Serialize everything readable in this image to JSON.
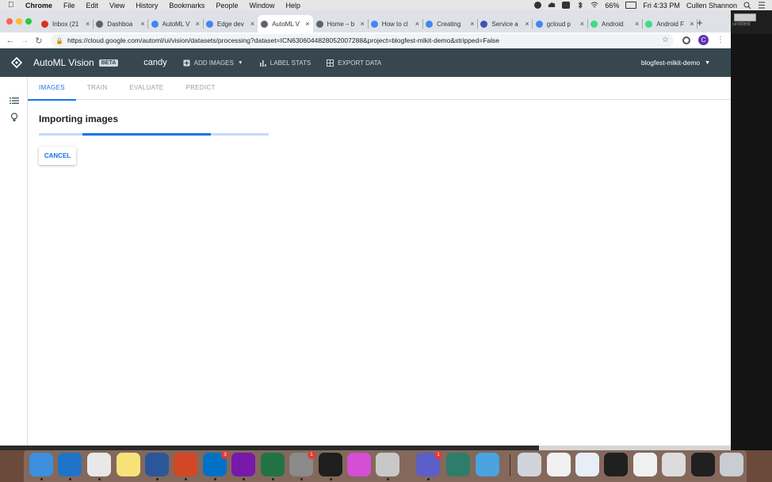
{
  "menubar": {
    "app": "Chrome",
    "items": [
      "File",
      "Edit",
      "View",
      "History",
      "Bookmarks",
      "People",
      "Window",
      "Help"
    ],
    "battery": "66%",
    "clock": "Fri 4:33 PM",
    "user": "Cullen Shannon"
  },
  "browser": {
    "tabs": [
      {
        "label": "Inbox (21",
        "icon": "gmail-icon",
        "color": "#d93025"
      },
      {
        "label": "Dashboa",
        "icon": "gear-icon",
        "color": "#5f6368"
      },
      {
        "label": "AutoML V",
        "icon": "gcloud-icon",
        "color": "#4285f4"
      },
      {
        "label": "Edge dev",
        "icon": "gcloud-icon",
        "color": "#4285f4"
      },
      {
        "label": "AutoML V",
        "icon": "gear-icon",
        "color": "#5f6368"
      },
      {
        "label": "Home – b",
        "icon": "gear-icon",
        "color": "#5f6368"
      },
      {
        "label": "How to cl",
        "icon": "gcloud-icon",
        "color": "#4285f4"
      },
      {
        "label": "Creating",
        "icon": "gcloud-icon",
        "color": "#4285f4"
      },
      {
        "label": "Service a",
        "icon": "shield-icon",
        "color": "#3f51b5"
      },
      {
        "label": "gcloud p",
        "icon": "google-icon",
        "color": "#4285f4"
      },
      {
        "label": "Android",
        "icon": "android-icon",
        "color": "#3ddc84"
      },
      {
        "label": "Android F",
        "icon": "android-icon",
        "color": "#3ddc84"
      }
    ],
    "active_tab": 4,
    "url": "https://cloud.google.com/automl/ui/vision/datasets/processing?dataset=ICN6306044828052007288&project=blogfest-mlkit-demo&stripped=False",
    "profile_initial": "C"
  },
  "app": {
    "name": "AutoML Vision",
    "beta": "BETA",
    "dataset": "candy",
    "actions": {
      "add_images": "ADD IMAGES",
      "label_stats": "LABEL STATS",
      "export_data": "EXPORT DATA"
    },
    "project": "blogfest-mlkit-demo",
    "tabs": [
      "IMAGES",
      "TRAIN",
      "EVALUATE",
      "PREDICT"
    ],
    "active_tab": 0,
    "status_title": "Importing images",
    "progress": {
      "start": 0.19,
      "end": 0.75
    },
    "cancel_label": "CANCEL"
  },
  "desktop": {
    "untitled": "untitled"
  },
  "dock": {
    "apps": [
      {
        "name": "finder-icon",
        "color": "#3d8fe0"
      },
      {
        "name": "sharepoint-icon",
        "color": "#1f74c9"
      },
      {
        "name": "chrome-icon",
        "color": "#e8e8e8"
      },
      {
        "name": "notes-icon",
        "color": "#f7e27a"
      },
      {
        "name": "word-icon",
        "color": "#2b579a"
      },
      {
        "name": "powerpoint-icon",
        "color": "#d24726"
      },
      {
        "name": "outlook-icon",
        "color": "#0072c6",
        "badge": "3"
      },
      {
        "name": "onenote-icon",
        "color": "#7719aa"
      },
      {
        "name": "excel-icon",
        "color": "#217346"
      },
      {
        "name": "system-preferences-icon",
        "color": "#8a8a8a",
        "badge": "1"
      },
      {
        "name": "terminal-icon",
        "color": "#1e1e1e"
      },
      {
        "name": "flower-icon",
        "color": "#d54ed5"
      },
      {
        "name": "disk-utility-icon",
        "color": "#c8c8c8"
      },
      {
        "name": "teams-icon",
        "color": "#5b5fc7",
        "badge": "1"
      },
      {
        "name": "sync-icon",
        "color": "#2e7d6a"
      },
      {
        "name": "chart-app-icon",
        "color": "#4aa3df"
      },
      {
        "name": "preview-icon",
        "color": "#d0d4da"
      },
      {
        "name": "document-thumb-icon",
        "color": "#f1f1f1"
      },
      {
        "name": "document-thumb-icon",
        "color": "#e8eef6"
      },
      {
        "name": "terminal-window-icon",
        "color": "#202020"
      },
      {
        "name": "document-thumb-icon",
        "color": "#f0f0f0"
      },
      {
        "name": "document-thumb-icon",
        "color": "#dcdcdc"
      },
      {
        "name": "terminal-window-icon",
        "color": "#202020"
      },
      {
        "name": "trash-icon",
        "color": "#c9ccd1"
      }
    ]
  }
}
